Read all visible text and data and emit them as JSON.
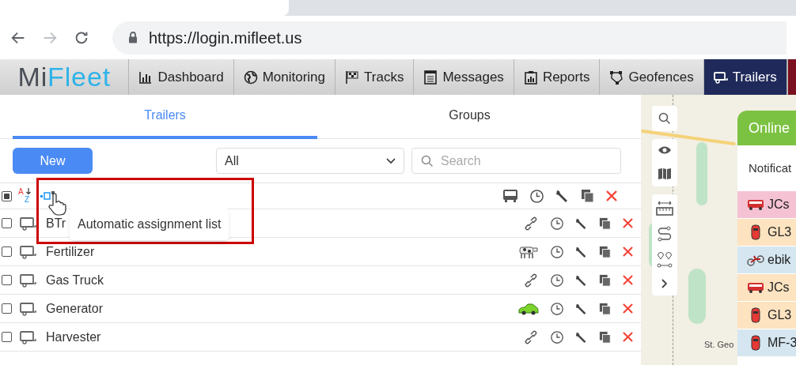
{
  "browser": {
    "url": "https://login.mifleet.us"
  },
  "nav": {
    "logo_left": "Mi",
    "logo_right": "Fleet",
    "items": [
      {
        "label": "Dashboard",
        "selected": false
      },
      {
        "label": "Monitoring",
        "selected": false
      },
      {
        "label": "Tracks",
        "selected": false
      },
      {
        "label": "Messages",
        "selected": false
      },
      {
        "label": "Reports",
        "selected": false
      },
      {
        "label": "Geofences",
        "selected": false
      },
      {
        "label": "Trailers",
        "selected": true
      }
    ]
  },
  "tabs": [
    {
      "label": "Trailers",
      "selected": true
    },
    {
      "label": "Groups",
      "selected": false
    }
  ],
  "toolbar": {
    "new_button": "New",
    "filter": "All",
    "search": {
      "placeholder": "Search"
    }
  },
  "header": {
    "checked": true,
    "sort_letters": [
      "A",
      "Z"
    ]
  },
  "tooltip": "Automatic assignment list",
  "rows": [
    {
      "name": "BTr",
      "kind": "link",
      "checked": false
    },
    {
      "name": "Fertilizer",
      "kind": "cow",
      "checked": false
    },
    {
      "name": "Gas Truck",
      "kind": "link",
      "checked": false
    },
    {
      "name": "Generator",
      "kind": "car",
      "checked": false
    },
    {
      "name": "Harvester",
      "kind": "link",
      "checked": false
    }
  ],
  "map": {
    "place_label": "St. Geo",
    "panel": {
      "title": "Online",
      "notification": "Notificat",
      "units": [
        {
          "name": "JCs",
          "kind": "bus",
          "color": "#f5c2d4"
        },
        {
          "name": "GL3",
          "kind": "car",
          "color": "#fde3c0"
        },
        {
          "name": "ebik",
          "kind": "bike",
          "color": "#d5e6f0"
        },
        {
          "name": "JCs",
          "kind": "bus",
          "color": "#fde3c0"
        },
        {
          "name": "GL3",
          "kind": "car",
          "color": "#fde3c0"
        },
        {
          "name": "MF-3",
          "kind": "car",
          "color": "#d5e6f0"
        }
      ]
    }
  }
}
